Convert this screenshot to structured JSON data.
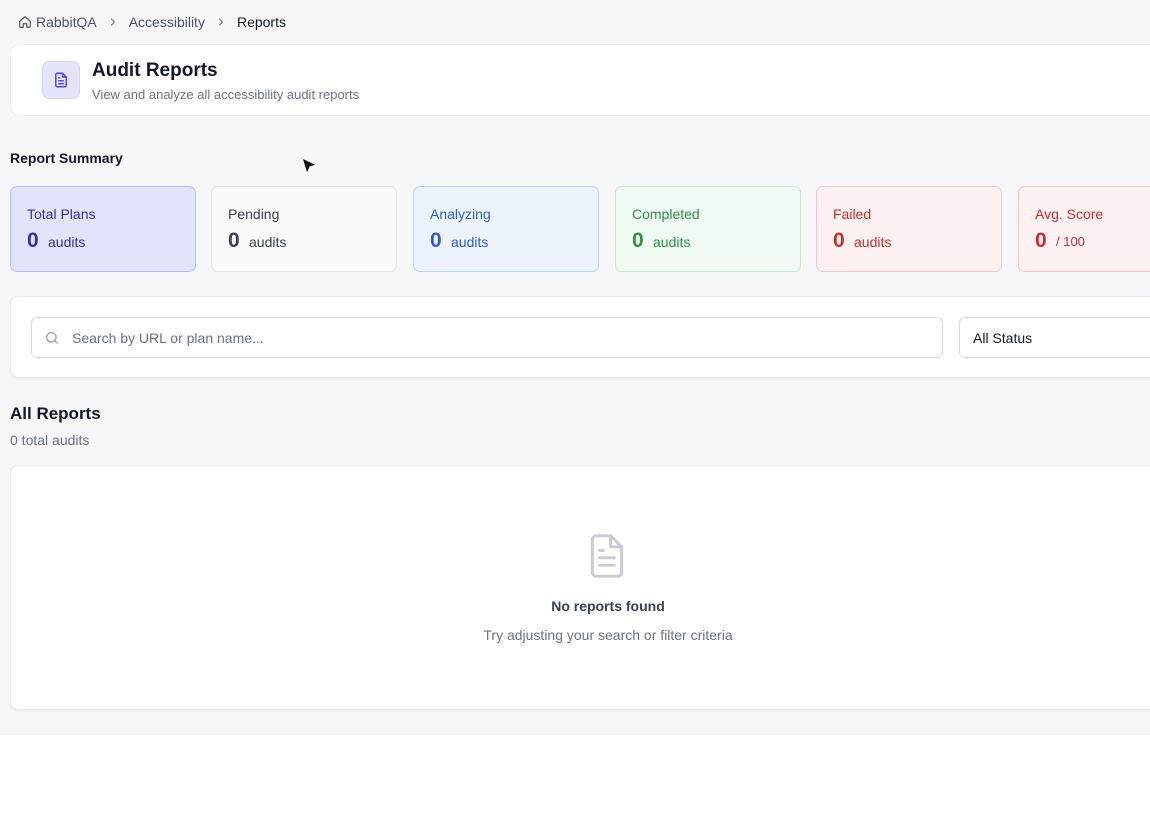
{
  "breadcrumb": {
    "items": [
      {
        "label": "RabbitQA",
        "icon": "home-icon"
      },
      {
        "label": "Accessibility"
      },
      {
        "label": "Reports"
      }
    ]
  },
  "header": {
    "icon": "document-icon",
    "title": "Audit Reports",
    "subtitle": "View and analyze all accessibility audit reports"
  },
  "summary": {
    "title": "Report Summary",
    "cards": [
      {
        "label": "Total Plans",
        "value": "0",
        "unit": "audits",
        "color": "#3730a3"
      },
      {
        "label": "Pending",
        "value": "0",
        "unit": "audits",
        "color": "#374151"
      },
      {
        "label": "Analyzing",
        "value": "0",
        "unit": "audits",
        "color": "#2f5fc7"
      },
      {
        "label": "Completed",
        "value": "0",
        "unit": "audits",
        "color": "#2f9146"
      },
      {
        "label": "Failed",
        "value": "0",
        "unit": "audits",
        "color": "#c2322f"
      },
      {
        "label": "Avg. Score",
        "value": "0",
        "unit": "/ 100",
        "color": "#c2322f"
      }
    ]
  },
  "filters": {
    "search": {
      "placeholder": "Search by URL or plan name...",
      "value": "",
      "icon": "search-icon"
    },
    "status": {
      "selected": "All Status"
    }
  },
  "reports": {
    "title": "All Reports",
    "count_text": "0 total audits",
    "empty": {
      "icon": "document-icon",
      "title": "No reports found",
      "subtitle": "Try adjusting your search or filter criteria"
    }
  },
  "colors": {
    "accent": "#4f46e5",
    "background": "#f6f7f9"
  }
}
